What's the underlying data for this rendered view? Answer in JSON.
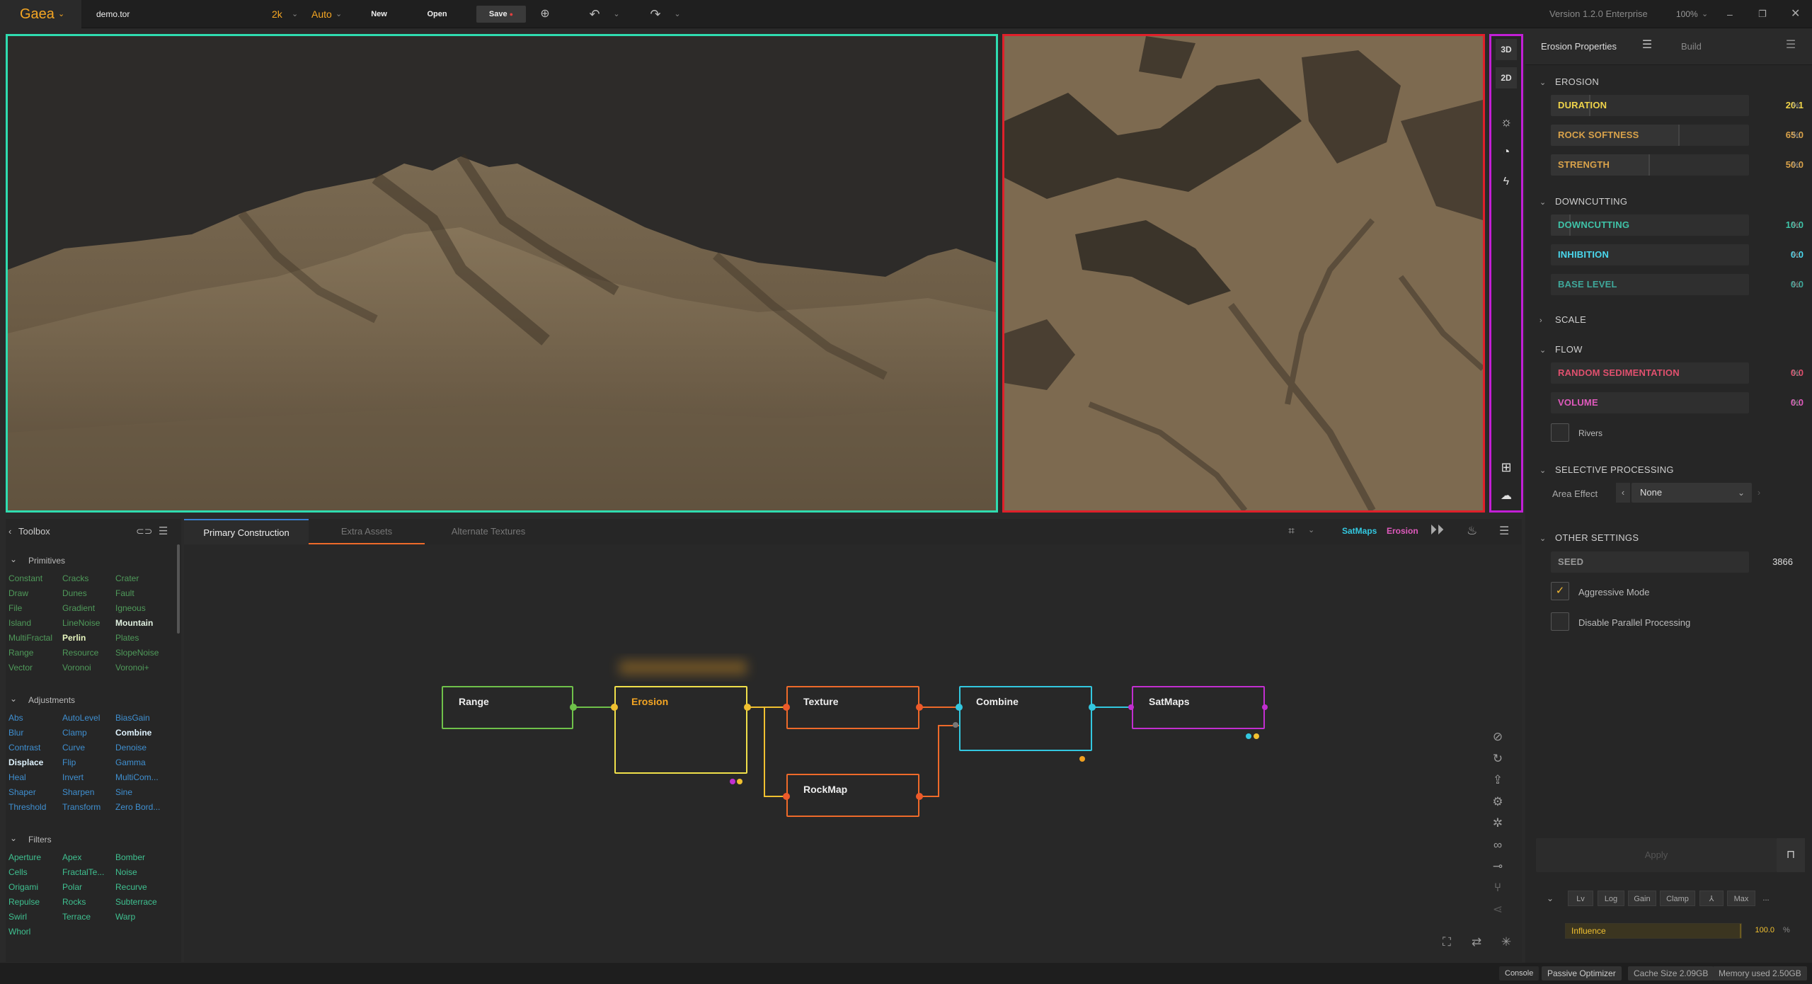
{
  "topbar": {
    "app_name": "Gaea",
    "file_name": "demo.tor",
    "resolution": "2k",
    "mode": "Auto",
    "new_label": "New",
    "open_label": "Open",
    "save_label": "Save",
    "version": "Version 1.2.0 Enterprise",
    "zoom": "100%"
  },
  "viewport_toolbar": {
    "mode_3d": "3D",
    "mode_2d": "2D"
  },
  "properties": {
    "tab_active": "Erosion Properties",
    "tab_build": "Build",
    "sections": {
      "erosion": "EROSION",
      "downcutting": "DOWNCUTTING",
      "scale": "SCALE",
      "flow": "FLOW",
      "selective": "SELECTIVE PROCESSING",
      "other": "OTHER SETTINGS"
    },
    "erosion": [
      {
        "label": "DURATION",
        "value": "20.1",
        "unit": "%",
        "fill": 0.201,
        "color": "#f0d44a"
      },
      {
        "label": "ROCK SOFTNESS",
        "value": "65.0",
        "unit": "%",
        "fill": 0.65,
        "color": "#d9a24a"
      },
      {
        "label": "STRENGTH",
        "value": "50.0",
        "unit": "%",
        "fill": 0.5,
        "color": "#d9a24a"
      }
    ],
    "downcutting": [
      {
        "label": "DOWNCUTTING",
        "value": "10.0",
        "unit": "%",
        "fill": 0.1,
        "color": "#3fc3a8"
      },
      {
        "label": "INHIBITION",
        "value": "0.0",
        "unit": "%",
        "fill": 0.0,
        "color": "#4ad8ee"
      },
      {
        "label": "BASE LEVEL",
        "value": "0.0",
        "unit": "%",
        "fill": 0.0,
        "color": "#3fa89b"
      }
    ],
    "flow": [
      {
        "label": "RANDOM SEDIMENTATION",
        "value": "0.0",
        "unit": "%",
        "fill": 0.0,
        "color": "#e0506e"
      },
      {
        "label": "VOLUME",
        "value": "0.0",
        "unit": "%",
        "fill": 0.0,
        "color": "#e05abd"
      }
    ],
    "rivers_label": "Rivers",
    "area_effect_label": "Area Effect",
    "area_effect_value": "None",
    "seed_label": "SEED",
    "seed_value": "3866",
    "aggressive_label": "Aggressive Mode",
    "aggressive_checked": true,
    "disable_parallel_label": "Disable Parallel Processing",
    "disable_parallel_checked": false,
    "apply_label": "Apply",
    "bottom_buttons": [
      "Lv",
      "Log",
      "Gain",
      "Clamp",
      "⅄",
      "Max",
      "..."
    ],
    "influence_label": "Influence",
    "influence_value": "100.0",
    "influence_unit": "%",
    "influence_fill": 1.0
  },
  "toolbox": {
    "title": "Toolbox",
    "categories": [
      {
        "name": "Primitives",
        "items": [
          [
            "Constant",
            "Cracks",
            "Crater"
          ],
          [
            "Draw",
            "Dunes",
            "Fault"
          ],
          [
            "File",
            "Gradient",
            "Igneous"
          ],
          [
            "Island",
            "LineNoise",
            "Mountain"
          ],
          [
            "MultiFractal",
            "Perlin",
            "Plates"
          ],
          [
            "Range",
            "Resource",
            "SlopeNoise"
          ],
          [
            "Vector",
            "Voronoi",
            "Voronoi+"
          ]
        ]
      },
      {
        "name": "Adjustments",
        "items": [
          [
            "Abs",
            "AutoLevel",
            "BiasGain"
          ],
          [
            "Blur",
            "Clamp",
            "Combine"
          ],
          [
            "Contrast",
            "Curve",
            "Denoise"
          ],
          [
            "Displace",
            "Flip",
            "Gamma"
          ],
          [
            "Heal",
            "Invert",
            "MultiCom..."
          ],
          [
            "Shaper",
            "Sharpen",
            "Sine"
          ],
          [
            "Threshold",
            "Transform",
            "Zero Bord..."
          ]
        ]
      },
      {
        "name": "Filters",
        "items": [
          [
            "Aperture",
            "Apex",
            "Bomber"
          ],
          [
            "Cells",
            "FractalTe...",
            "Noise"
          ],
          [
            "Origami",
            "Polar",
            "Recurve"
          ],
          [
            "Repulse",
            "Rocks",
            "Subterrace"
          ],
          [
            "Swirl",
            "Terrace",
            "Warp"
          ],
          [
            "Whorl"
          ]
        ]
      }
    ]
  },
  "graph": {
    "tabs": [
      "Primary Construction",
      "Extra Assets",
      "Alternate Textures"
    ],
    "active_tab": 0,
    "header_satmaps": "SatMaps",
    "header_erosion": "Erosion",
    "nodes": [
      {
        "title": "Range",
        "color": "#6fc14a"
      },
      {
        "title": "Erosion",
        "color": "#f0e04a"
      },
      {
        "title": "Texture",
        "color": "#ee6a2a"
      },
      {
        "title": "RockMap",
        "color": "#ee6a2a"
      },
      {
        "title": "Combine",
        "color": "#33c8e0"
      },
      {
        "title": "SatMaps",
        "color": "#c22fd0"
      }
    ]
  },
  "statusbar": {
    "console": "Console",
    "passive": "Passive Optimizer",
    "cache": "Cache Size 2.09GB",
    "memory": "Memory used 2.50GB"
  },
  "colors": {
    "accent": "#f5a623",
    "viewport3d_border": "#2fdcb0",
    "viewport2d_border": "#e0202a",
    "toolbar_border": "#c21fd6"
  }
}
